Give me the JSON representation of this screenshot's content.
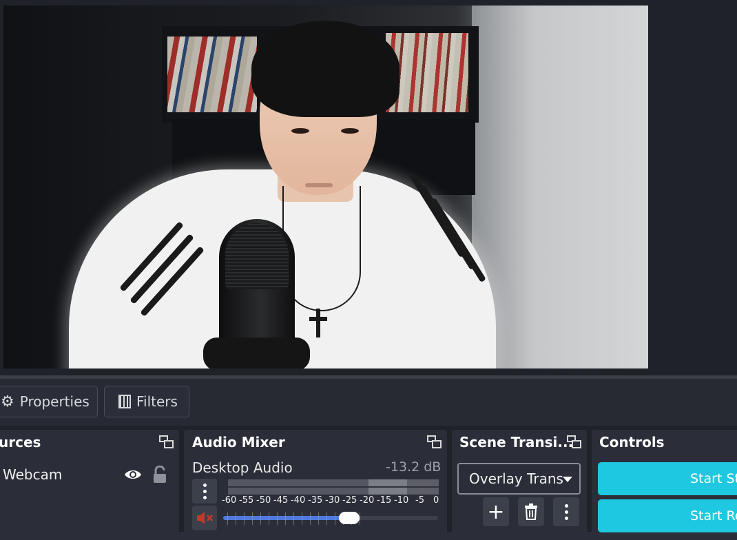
{
  "toolbar": {
    "properties_label": "Properties",
    "filters_label": "Filters"
  },
  "sources": {
    "title": "urces",
    "items": [
      {
        "label": "Webcam",
        "visible": true,
        "locked": true
      }
    ]
  },
  "audio_mixer": {
    "title": "Audio Mixer",
    "channel_name": "Desktop Audio",
    "level": "-13.2 dB",
    "meter_ticks": [
      "-60",
      "-55",
      "-50",
      "-45",
      "-40",
      "-35",
      "-30",
      "-25",
      "-20",
      "-15",
      "-10",
      "-5",
      "0"
    ],
    "muted": true,
    "volume_fraction": 0.58,
    "accent_color": "#4f78e0"
  },
  "scene_transitions": {
    "title": "Scene Transi...",
    "selected": "Overlay Trans",
    "add_glyph": "+",
    "more_glyph": "⋮"
  },
  "controls": {
    "title": "Controls",
    "start_streaming_label": "Start St",
    "start_recording_label": "Start Re",
    "button_color": "#1ec8e0"
  },
  "icons": [
    "gear-icon",
    "filters-icon",
    "float-dock-icon",
    "eye-icon",
    "lock-icon",
    "kebab-icon",
    "speaker-muted-icon",
    "chevron-down-icon",
    "plus-icon",
    "trash-icon"
  ]
}
